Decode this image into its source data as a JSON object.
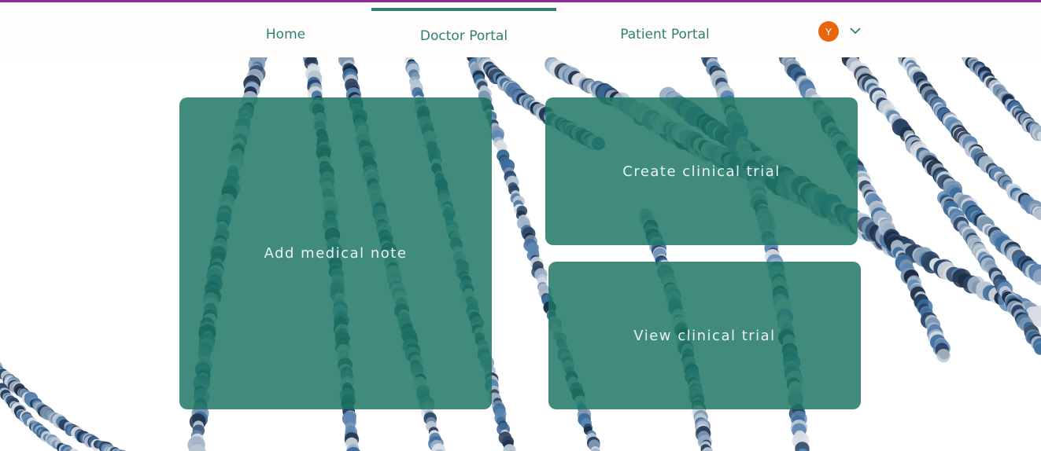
{
  "nav": {
    "items": [
      {
        "label": "Home"
      },
      {
        "label": "Doctor Portal",
        "active": true
      },
      {
        "label": "Patient Portal"
      }
    ]
  },
  "user": {
    "initial": "Y",
    "avatar_color": "#e8660d"
  },
  "cards": {
    "add_note": "Add medical note",
    "create_trial": "Create clinical trial",
    "view_trial": "View clinical trial"
  },
  "colors": {
    "accent": "#2e7f72",
    "top_bar": "#8e2c9e",
    "card": "#1b7562"
  },
  "icons": {
    "menu": "chevron-down-icon"
  }
}
